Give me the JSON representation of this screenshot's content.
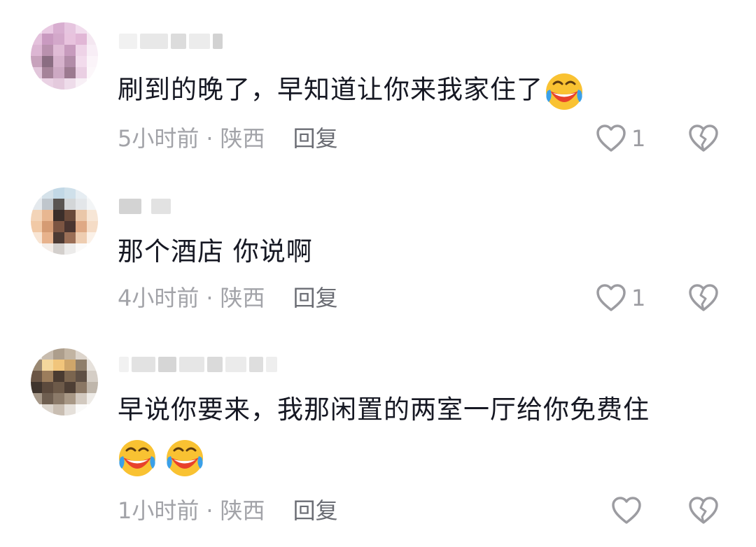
{
  "comments": [
    {
      "text": "刷到的晚了，早知道让你来我家住了",
      "time": "5小时前",
      "dot": "·",
      "location": "陕西",
      "reply_label": "回复",
      "like_count": "1"
    },
    {
      "text": "那个酒店 你说啊",
      "time": "4小时前",
      "dot": "·",
      "location": "陕西",
      "reply_label": "回复",
      "like_count": "1"
    },
    {
      "text": "早说你要来，我那闲置的两室一厅给你免费住",
      "time": "1小时前",
      "dot": "·",
      "location": "陕西",
      "reply_label": "回复",
      "like_count": ""
    }
  ],
  "icons": {
    "like": "heart-outline-icon",
    "dislike": "broken-heart-icon",
    "emoji": "laughing-crying-emoji"
  },
  "colors": {
    "text": "#161823",
    "meta": "#a2a3a8",
    "reply": "#6b6d74",
    "icon": "#9c9ca1"
  }
}
